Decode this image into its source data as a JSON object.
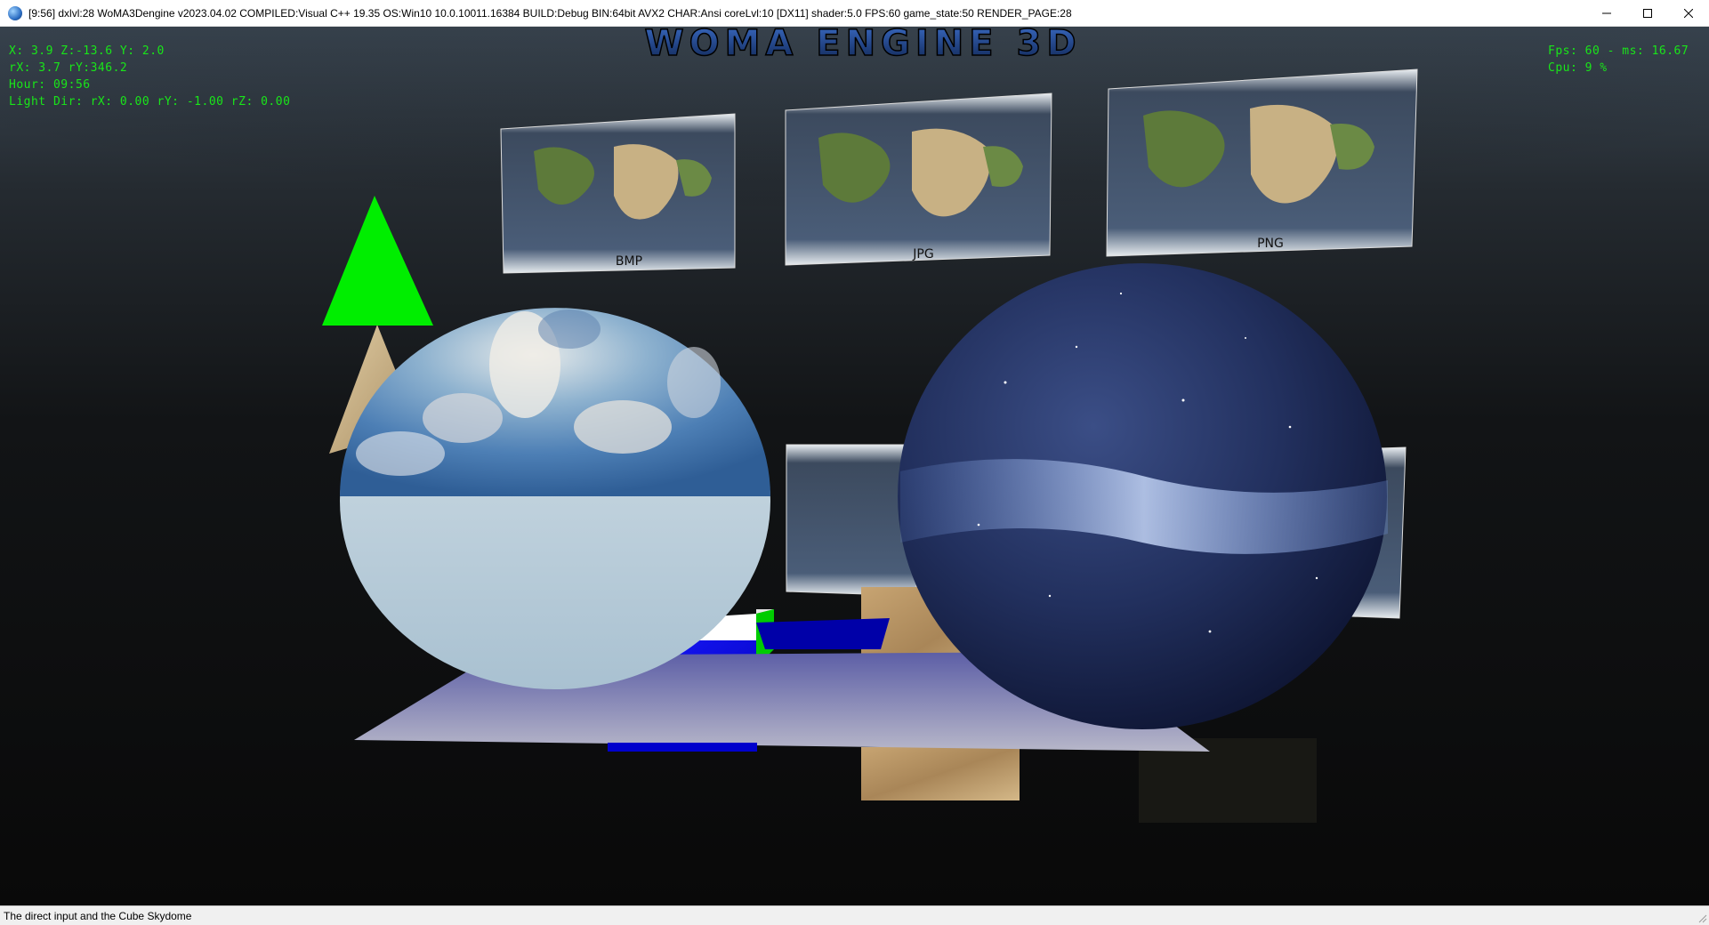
{
  "window": {
    "title": "[9:56] dxlvl:28 WoMA3Dengine v2023.04.02 COMPILED:Visual C++ 19.35 OS:Win10 10.0.10011.16384 BUILD:Debug BIN:64bit AVX2 CHAR:Ansi coreLvl:10 [DX11] shader:5.0 FPS:60 game_state:50 RENDER_PAGE:28",
    "controls": [
      "minimize-icon",
      "maximize-icon",
      "close-icon"
    ]
  },
  "scene": {
    "logo_text": "WOMA ENGINE 3D",
    "panels": [
      {
        "label": "BMP"
      },
      {
        "label": "JPG"
      },
      {
        "label": "PNG"
      }
    ],
    "colors": {
      "triangle": "#00ee00",
      "cube_front": "#0000ff",
      "cube_side": "#00dd00",
      "hud_text": "#19e619",
      "logo_fill": "#1d3d7a"
    }
  },
  "hud": {
    "left": [
      "X: 3.9 Z:-13.6 Y: 2.0",
      "rX: 3.7 rY:346.2",
      "Hour: 09:56",
      "Light Dir: rX: 0.00 rY: -1.00 rZ: 0.00"
    ],
    "right": [
      "Fps: 60 - ms: 16.67",
      "Cpu: 9 %"
    ]
  },
  "status": {
    "text": "The direct input and the Cube Skydome"
  }
}
